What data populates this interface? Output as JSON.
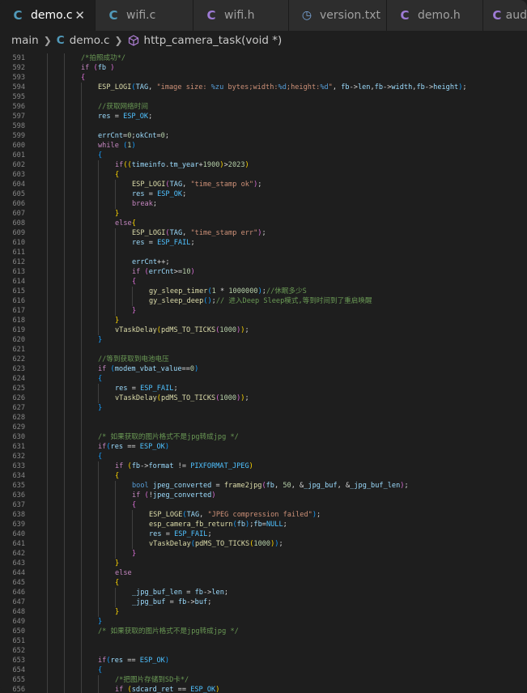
{
  "tabs": [
    {
      "label": "demo.c",
      "icon": "c-file-icon",
      "active": true
    },
    {
      "label": "wifi.c",
      "icon": "c-file-icon"
    },
    {
      "label": "wifi.h",
      "icon": "c-header-icon"
    },
    {
      "label": "version.txt",
      "icon": "text-clock-icon"
    },
    {
      "label": "demo.h",
      "icon": "c-header-icon"
    },
    {
      "label": "aud",
      "icon": "c-header-icon"
    }
  ],
  "breadcrumb": {
    "folder": "main",
    "file": "demo.c",
    "symbol": "http_camera_task(void *)"
  },
  "colors": {
    "keyword": "#c586c0",
    "type": "#569cd6",
    "function": "#dcdcaa",
    "string": "#ce9178",
    "number": "#b5cea8",
    "comment": "#6a9955",
    "variable": "#9cdcfe",
    "macro": "#4fc1ff"
  },
  "lines": [
    {
      "n": "591",
      "i": 2,
      "t": [
        [
          "cm",
          "/*拍照成功*/"
        ]
      ]
    },
    {
      "n": "592",
      "i": 2,
      "t": [
        [
          "kw",
          "if"
        ],
        [
          "op",
          " "
        ],
        [
          "b2",
          "("
        ],
        [
          "va",
          "fb"
        ],
        [
          "op",
          " "
        ],
        [
          "b2",
          ")"
        ]
      ]
    },
    {
      "n": "593",
      "i": 2,
      "t": [
        [
          "b2",
          "{"
        ]
      ]
    },
    {
      "n": "594",
      "i": 3,
      "t": [
        [
          "fn",
          "ESP_LOGI"
        ],
        [
          "b3",
          "("
        ],
        [
          "va",
          "TAG"
        ],
        [
          "op",
          ", "
        ],
        [
          "st",
          "\"image size: "
        ],
        [
          "ty",
          "%zu"
        ],
        [
          "st",
          " bytes;width:"
        ],
        [
          "ty",
          "%d"
        ],
        [
          "st",
          ";height:"
        ],
        [
          "ty",
          "%d"
        ],
        [
          "st",
          "\""
        ],
        [
          "op",
          ", "
        ],
        [
          "va",
          "fb"
        ],
        [
          "op",
          "->"
        ],
        [
          "va",
          "len"
        ],
        [
          "op",
          ","
        ],
        [
          "va",
          "fb"
        ],
        [
          "op",
          "->"
        ],
        [
          "va",
          "width"
        ],
        [
          "op",
          ","
        ],
        [
          "va",
          "fb"
        ],
        [
          "op",
          "->"
        ],
        [
          "va",
          "height"
        ],
        [
          "b3",
          ")"
        ],
        [
          "op",
          ";"
        ]
      ]
    },
    {
      "n": "595",
      "i": 3,
      "t": []
    },
    {
      "n": "596",
      "i": 3,
      "t": [
        [
          "cm",
          "//获取网络时间"
        ]
      ]
    },
    {
      "n": "597",
      "i": 3,
      "t": [
        [
          "va",
          "res"
        ],
        [
          "op",
          " = "
        ],
        [
          "mc",
          "ESP_OK"
        ],
        [
          "op",
          ";"
        ]
      ]
    },
    {
      "n": "598",
      "i": 3,
      "t": []
    },
    {
      "n": "599",
      "i": 3,
      "t": [
        [
          "va",
          "errCnt"
        ],
        [
          "op",
          "="
        ],
        [
          "nu",
          "0"
        ],
        [
          "op",
          ";"
        ],
        [
          "va",
          "okCnt"
        ],
        [
          "op",
          "="
        ],
        [
          "nu",
          "0"
        ],
        [
          "op",
          ";"
        ]
      ]
    },
    {
      "n": "600",
      "i": 3,
      "t": [
        [
          "kw",
          "while"
        ],
        [
          "op",
          " "
        ],
        [
          "b3",
          "("
        ],
        [
          "nu",
          "1"
        ],
        [
          "b3",
          ")"
        ]
      ]
    },
    {
      "n": "601",
      "i": 3,
      "t": [
        [
          "b3",
          "{"
        ]
      ]
    },
    {
      "n": "602",
      "i": 4,
      "t": [
        [
          "kw",
          "if"
        ],
        [
          "b1",
          "(("
        ],
        [
          "va",
          "timeinfo"
        ],
        [
          "op",
          "."
        ],
        [
          "va",
          "tm_year"
        ],
        [
          "op",
          "+"
        ],
        [
          "nu",
          "1900"
        ],
        [
          "b1",
          ")"
        ],
        [
          "op",
          ">"
        ],
        [
          "nu",
          "2023"
        ],
        [
          "b1",
          ")"
        ]
      ]
    },
    {
      "n": "603",
      "i": 4,
      "t": [
        [
          "b1",
          "{"
        ]
      ]
    },
    {
      "n": "604",
      "i": 5,
      "t": [
        [
          "fn",
          "ESP_LOGI"
        ],
        [
          "b2",
          "("
        ],
        [
          "va",
          "TAG"
        ],
        [
          "op",
          ", "
        ],
        [
          "st",
          "\"time_stamp ok\""
        ],
        [
          "b2",
          ")"
        ],
        [
          "op",
          ";"
        ]
      ]
    },
    {
      "n": "605",
      "i": 5,
      "t": [
        [
          "va",
          "res"
        ],
        [
          "op",
          " = "
        ],
        [
          "mc",
          "ESP_OK"
        ],
        [
          "op",
          ";"
        ]
      ]
    },
    {
      "n": "606",
      "i": 5,
      "t": [
        [
          "kw",
          "break"
        ],
        [
          "op",
          ";"
        ]
      ]
    },
    {
      "n": "607",
      "i": 4,
      "t": [
        [
          "b1",
          "}"
        ]
      ]
    },
    {
      "n": "608",
      "i": 4,
      "t": [
        [
          "kw",
          "else"
        ],
        [
          "b1",
          "{"
        ]
      ]
    },
    {
      "n": "609",
      "i": 5,
      "t": [
        [
          "fn",
          "ESP_LOGI"
        ],
        [
          "b2",
          "("
        ],
        [
          "va",
          "TAG"
        ],
        [
          "op",
          ", "
        ],
        [
          "st",
          "\"time_stamp err\""
        ],
        [
          "b2",
          ")"
        ],
        [
          "op",
          ";"
        ]
      ]
    },
    {
      "n": "610",
      "i": 5,
      "t": [
        [
          "va",
          "res"
        ],
        [
          "op",
          " = "
        ],
        [
          "mc",
          "ESP_FAIL"
        ],
        [
          "op",
          ";"
        ]
      ]
    },
    {
      "n": "611",
      "i": 5,
      "t": []
    },
    {
      "n": "612",
      "i": 5,
      "t": [
        [
          "va",
          "errCnt"
        ],
        [
          "op",
          "++;"
        ]
      ]
    },
    {
      "n": "613",
      "i": 5,
      "t": [
        [
          "kw",
          "if"
        ],
        [
          "op",
          " "
        ],
        [
          "b2",
          "("
        ],
        [
          "va",
          "errCnt"
        ],
        [
          "op",
          ">="
        ],
        [
          "nu",
          "10"
        ],
        [
          "b2",
          ")"
        ]
      ]
    },
    {
      "n": "614",
      "i": 5,
      "t": [
        [
          "b2",
          "{"
        ]
      ]
    },
    {
      "n": "615",
      "i": 6,
      "t": [
        [
          "fn",
          "gy_sleep_timer"
        ],
        [
          "b3",
          "("
        ],
        [
          "nu",
          "1"
        ],
        [
          "op",
          " * "
        ],
        [
          "nu",
          "1000000"
        ],
        [
          "b3",
          ")"
        ],
        [
          "op",
          ";"
        ],
        [
          "cm",
          "//休眠多少S"
        ]
      ]
    },
    {
      "n": "616",
      "i": 6,
      "t": [
        [
          "fn",
          "gy_sleep_deep"
        ],
        [
          "b3",
          "()"
        ],
        [
          "op",
          ";"
        ],
        [
          "cm",
          "// 进入Deep Sleep模式,等到时间到了重启唤醒"
        ]
      ]
    },
    {
      "n": "617",
      "i": 5,
      "t": [
        [
          "b2",
          "}"
        ]
      ]
    },
    {
      "n": "618",
      "i": 4,
      "t": [
        [
          "b1",
          "}"
        ]
      ]
    },
    {
      "n": "619",
      "i": 4,
      "t": [
        [
          "fn",
          "vTaskDelay"
        ],
        [
          "b1",
          "("
        ],
        [
          "fn",
          "pdMS_TO_TICKS"
        ],
        [
          "b2",
          "("
        ],
        [
          "nu",
          "1000"
        ],
        [
          "b2",
          ")"
        ],
        [
          "b1",
          ")"
        ],
        [
          "op",
          ";"
        ]
      ]
    },
    {
      "n": "620",
      "i": 3,
      "t": [
        [
          "b3",
          "}"
        ]
      ]
    },
    {
      "n": "621",
      "i": 3,
      "t": []
    },
    {
      "n": "622",
      "i": 3,
      "t": [
        [
          "cm",
          "//等到获取到电池电压"
        ]
      ]
    },
    {
      "n": "623",
      "i": 3,
      "t": [
        [
          "kw",
          "if"
        ],
        [
          "op",
          " "
        ],
        [
          "b3",
          "("
        ],
        [
          "va",
          "modem_vbat_value"
        ],
        [
          "op",
          "=="
        ],
        [
          "nu",
          "0"
        ],
        [
          "b3",
          ")"
        ]
      ]
    },
    {
      "n": "624",
      "i": 3,
      "t": [
        [
          "b3",
          "{"
        ]
      ]
    },
    {
      "n": "625",
      "i": 4,
      "t": [
        [
          "va",
          "res"
        ],
        [
          "op",
          " = "
        ],
        [
          "mc",
          "ESP_FAIL"
        ],
        [
          "op",
          ";"
        ]
      ]
    },
    {
      "n": "626",
      "i": 4,
      "t": [
        [
          "fn",
          "vTaskDelay"
        ],
        [
          "b1",
          "("
        ],
        [
          "fn",
          "pdMS_TO_TICKS"
        ],
        [
          "b2",
          "("
        ],
        [
          "nu",
          "1000"
        ],
        [
          "b2",
          ")"
        ],
        [
          "b1",
          ")"
        ],
        [
          "op",
          ";"
        ]
      ]
    },
    {
      "n": "627",
      "i": 3,
      "t": [
        [
          "b3",
          "}"
        ]
      ]
    },
    {
      "n": "628",
      "i": 3,
      "t": []
    },
    {
      "n": "629",
      "i": 3,
      "t": []
    },
    {
      "n": "630",
      "i": 3,
      "t": [
        [
          "cm",
          "/* 如果获取的图片格式不是jpg转成jpg */"
        ]
      ]
    },
    {
      "n": "631",
      "i": 3,
      "t": [
        [
          "kw",
          "if"
        ],
        [
          "b3",
          "("
        ],
        [
          "va",
          "res"
        ],
        [
          "op",
          " == "
        ],
        [
          "mc",
          "ESP_OK"
        ],
        [
          "b3",
          ")"
        ]
      ]
    },
    {
      "n": "632",
      "i": 3,
      "t": [
        [
          "b3",
          "{"
        ]
      ]
    },
    {
      "n": "633",
      "i": 4,
      "t": [
        [
          "kw",
          "if"
        ],
        [
          "op",
          " "
        ],
        [
          "b1",
          "("
        ],
        [
          "va",
          "fb"
        ],
        [
          "op",
          "->"
        ],
        [
          "va",
          "format"
        ],
        [
          "op",
          " != "
        ],
        [
          "mc",
          "PIXFORMAT_JPEG"
        ],
        [
          "b1",
          ")"
        ]
      ]
    },
    {
      "n": "634",
      "i": 4,
      "t": [
        [
          "b1",
          "{"
        ]
      ]
    },
    {
      "n": "635",
      "i": 5,
      "t": [
        [
          "ty",
          "bool"
        ],
        [
          "op",
          " "
        ],
        [
          "va",
          "jpeg_converted"
        ],
        [
          "op",
          " = "
        ],
        [
          "fn",
          "frame2jpg"
        ],
        [
          "b2",
          "("
        ],
        [
          "va",
          "fb"
        ],
        [
          "op",
          ", "
        ],
        [
          "nu",
          "50"
        ],
        [
          "op",
          ", &"
        ],
        [
          "va",
          "_jpg_buf"
        ],
        [
          "op",
          ", &"
        ],
        [
          "va",
          "_jpg_buf_len"
        ],
        [
          "b2",
          ")"
        ],
        [
          "op",
          ";"
        ]
      ]
    },
    {
      "n": "636",
      "i": 5,
      "t": [
        [
          "kw",
          "if"
        ],
        [
          "op",
          " "
        ],
        [
          "b2",
          "("
        ],
        [
          "op",
          "!"
        ],
        [
          "va",
          "jpeg_converted"
        ],
        [
          "b2",
          ")"
        ]
      ]
    },
    {
      "n": "637",
      "i": 5,
      "t": [
        [
          "b2",
          "{"
        ]
      ]
    },
    {
      "n": "638",
      "i": 6,
      "t": [
        [
          "fn",
          "ESP_LOGE"
        ],
        [
          "b3",
          "("
        ],
        [
          "va",
          "TAG"
        ],
        [
          "op",
          ", "
        ],
        [
          "st",
          "\"JPEG compression failed\""
        ],
        [
          "b3",
          ")"
        ],
        [
          "op",
          ";"
        ]
      ]
    },
    {
      "n": "639",
      "i": 6,
      "t": [
        [
          "fn",
          "esp_camera_fb_return"
        ],
        [
          "b3",
          "("
        ],
        [
          "va",
          "fb"
        ],
        [
          "b3",
          ")"
        ],
        [
          "op",
          ";"
        ],
        [
          "va",
          "fb"
        ],
        [
          "op",
          "="
        ],
        [
          "mc",
          "NULL"
        ],
        [
          "op",
          ";"
        ]
      ]
    },
    {
      "n": "640",
      "i": 6,
      "t": [
        [
          "va",
          "res"
        ],
        [
          "op",
          " = "
        ],
        [
          "mc",
          "ESP_FAIL"
        ],
        [
          "op",
          ";"
        ]
      ]
    },
    {
      "n": "641",
      "i": 6,
      "t": [
        [
          "fn",
          "vTaskDelay"
        ],
        [
          "b3",
          "("
        ],
        [
          "fn",
          "pdMS_TO_TICKS"
        ],
        [
          "b1",
          "("
        ],
        [
          "nu",
          "1000"
        ],
        [
          "b1",
          ")"
        ],
        [
          "b3",
          ")"
        ],
        [
          "op",
          ";"
        ]
      ]
    },
    {
      "n": "642",
      "i": 5,
      "t": [
        [
          "b2",
          "}"
        ]
      ]
    },
    {
      "n": "643",
      "i": 4,
      "t": [
        [
          "b1",
          "}"
        ]
      ]
    },
    {
      "n": "644",
      "i": 4,
      "t": [
        [
          "kw",
          "else"
        ]
      ]
    },
    {
      "n": "645",
      "i": 4,
      "t": [
        [
          "b1",
          "{"
        ]
      ]
    },
    {
      "n": "646",
      "i": 5,
      "t": [
        [
          "va",
          "_jpg_buf_len"
        ],
        [
          "op",
          " = "
        ],
        [
          "va",
          "fb"
        ],
        [
          "op",
          "->"
        ],
        [
          "va",
          "len"
        ],
        [
          "op",
          ";"
        ]
      ]
    },
    {
      "n": "647",
      "i": 5,
      "t": [
        [
          "va",
          "_jpg_buf"
        ],
        [
          "op",
          " = "
        ],
        [
          "va",
          "fb"
        ],
        [
          "op",
          "->"
        ],
        [
          "va",
          "buf"
        ],
        [
          "op",
          ";"
        ]
      ]
    },
    {
      "n": "648",
      "i": 4,
      "t": [
        [
          "b1",
          "}"
        ]
      ]
    },
    {
      "n": "649",
      "i": 3,
      "t": [
        [
          "b3",
          "}"
        ]
      ]
    },
    {
      "n": "650",
      "i": 3,
      "t": [
        [
          "cm",
          "/* 如果获取的图片格式不是jpg转成jpg */"
        ]
      ]
    },
    {
      "n": "651",
      "i": 3,
      "t": []
    },
    {
      "n": "652",
      "i": 3,
      "t": []
    },
    {
      "n": "653",
      "i": 3,
      "t": [
        [
          "kw",
          "if"
        ],
        [
          "b3",
          "("
        ],
        [
          "va",
          "res"
        ],
        [
          "op",
          " == "
        ],
        [
          "mc",
          "ESP_OK"
        ],
        [
          "b3",
          ")"
        ]
      ]
    },
    {
      "n": "654",
      "i": 3,
      "t": [
        [
          "b3",
          "{"
        ]
      ]
    },
    {
      "n": "655",
      "i": 4,
      "t": [
        [
          "cm",
          "/*把图片存储到SD卡*/"
        ]
      ]
    },
    {
      "n": "656",
      "i": 4,
      "t": [
        [
          "kw",
          "if"
        ],
        [
          "op",
          " "
        ],
        [
          "b1",
          "("
        ],
        [
          "va",
          "sdcard_ret"
        ],
        [
          "op",
          " == "
        ],
        [
          "mc",
          "ESP_OK"
        ],
        [
          "b1",
          ")"
        ]
      ]
    }
  ]
}
